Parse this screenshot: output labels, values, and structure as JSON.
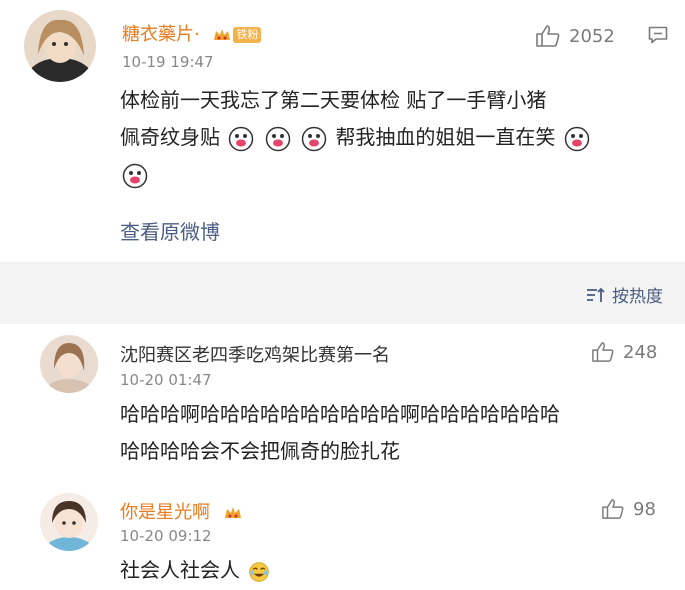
{
  "post": {
    "username": "糖衣藥片·",
    "badge_label": "铁粉",
    "time": "10-19 19:47",
    "text_line1": "体检前一天我忘了第二天要体检 贴了一手臂小猪",
    "text_line2a": "佩奇纹身贴",
    "text_line2b": "帮我抽血的姐姐一直在笑",
    "likes": "2052",
    "view_original": "查看原微博"
  },
  "sort": {
    "label": "按热度"
  },
  "comments": [
    {
      "username": "沈阳赛区老四季吃鸡架比赛第一名",
      "time": "10-20 01:47",
      "text_line1": "哈哈哈啊哈哈哈哈哈哈哈哈哈哈啊哈哈哈哈哈哈哈",
      "text_line2": "哈哈哈哈会不会把佩奇的脸扎花",
      "likes": "248"
    },
    {
      "username": "你是星光啊",
      "time": "10-20 09:12",
      "text": "社会人社会人",
      "likes": "98"
    }
  ],
  "colors": {
    "username_vip": "#ea7b1f",
    "link": "#4a5e82",
    "divider_bg": "#f3f3f3"
  }
}
